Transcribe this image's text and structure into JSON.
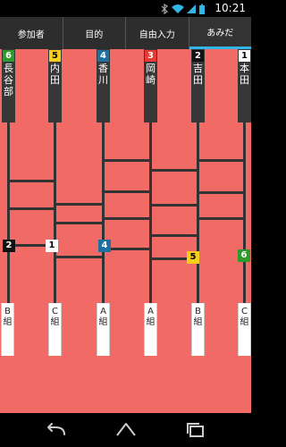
{
  "status": {
    "time": "10:21"
  },
  "tabs": [
    {
      "label": "参加者",
      "active": false
    },
    {
      "label": "目的",
      "active": false
    },
    {
      "label": "自由入力",
      "active": false
    },
    {
      "label": "あみだ",
      "active": true
    }
  ],
  "participants": [
    {
      "number": "6",
      "name": "長谷部",
      "badge_color": "#2e9a2e",
      "badge_text_color": "#ffffff"
    },
    {
      "number": "5",
      "name": "内田",
      "badge_color": "#f5cf1a",
      "badge_text_color": "#000000"
    },
    {
      "number": "4",
      "name": "香川",
      "badge_color": "#1f6fa0",
      "badge_text_color": "#ffffff"
    },
    {
      "number": "3",
      "name": "岡崎",
      "badge_color": "#e53935",
      "badge_text_color": "#ffffff"
    },
    {
      "number": "2",
      "name": "吉田",
      "badge_color": "#111111",
      "badge_text_color": "#ffffff"
    },
    {
      "number": "1",
      "name": "本田",
      "badge_color": "#ffffff",
      "badge_text_color": "#000000"
    }
  ],
  "markers": [
    {
      "number": "2",
      "color": "#111111",
      "text_color": "#ffffff"
    },
    {
      "number": "1",
      "color": "#ffffff",
      "text_color": "#000000"
    },
    {
      "number": "4",
      "color": "#1f6fa0",
      "text_color": "#ffffff"
    },
    {
      "number": "5",
      "color": "#f5cf1a",
      "text_color": "#000000"
    },
    {
      "number": "6",
      "color": "#2e9a2e",
      "text_color": "#ffffff"
    }
  ],
  "groups": [
    {
      "letter": "B",
      "suffix": "組"
    },
    {
      "letter": "C",
      "suffix": "組"
    },
    {
      "letter": "A",
      "suffix": "組"
    },
    {
      "letter": "A",
      "suffix": "組"
    },
    {
      "letter": "B",
      "suffix": "組"
    },
    {
      "letter": "C",
      "suffix": "組"
    }
  ],
  "colors": {
    "board": "#f26a66",
    "ladder": "#333333",
    "tab_bar": "#2d2d2d",
    "tab_indicator": "#33b5e5"
  },
  "icons": [
    "bluetooth-icon",
    "wifi-icon",
    "signal-icon",
    "battery-icon",
    "back-icon",
    "home-icon",
    "recents-icon"
  ]
}
